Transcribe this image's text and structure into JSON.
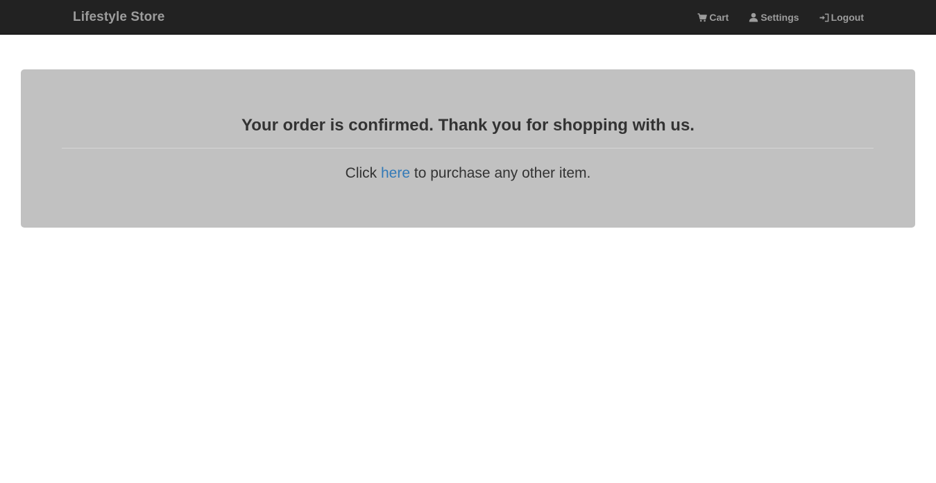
{
  "navbar": {
    "brand": "Lifestyle Store",
    "items": [
      {
        "label": "Cart",
        "icon": "shopping-cart-icon"
      },
      {
        "label": "Settings",
        "icon": "user-icon"
      },
      {
        "label": "Logout",
        "icon": "log-in-icon"
      }
    ]
  },
  "confirmation": {
    "heading": "Your order is confirmed. Thank you for shopping with us.",
    "line_prefix": "Click ",
    "link_text": "here",
    "line_suffix": " to purchase any other item."
  },
  "colors": {
    "navbar_bg": "#222222",
    "navbar_text": "#9d9d9d",
    "panel_bg": "#c1c1c1",
    "link": "#337ab7",
    "text": "#333333"
  }
}
